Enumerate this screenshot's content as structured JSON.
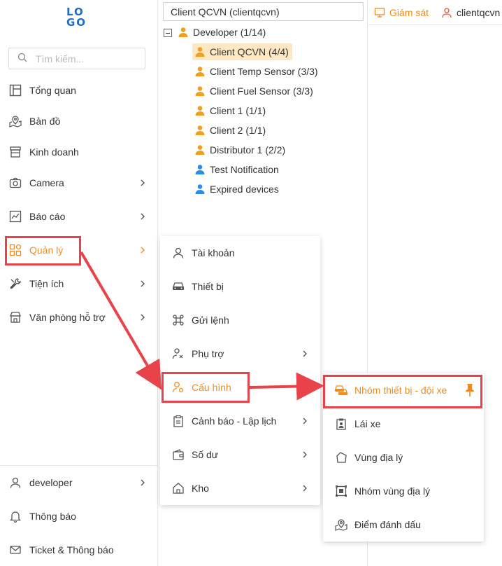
{
  "logo": {
    "line1": "LO",
    "line2": "GO"
  },
  "search": {
    "placeholder": "Tìm kiếm..."
  },
  "sidebar": {
    "items": [
      {
        "label": "Tổng quan",
        "icon": "dashboard-icon"
      },
      {
        "label": "Bản đồ",
        "icon": "map-icon"
      },
      {
        "label": "Kinh doanh",
        "icon": "store-icon"
      },
      {
        "label": "Camera",
        "icon": "camera-icon"
      },
      {
        "label": "Báo cáo",
        "icon": "report-icon"
      },
      {
        "label": "Quản lý",
        "icon": "grid-icon"
      },
      {
        "label": "Tiện ích",
        "icon": "tools-icon"
      },
      {
        "label": "Văn phòng hỗ trợ",
        "icon": "office-icon"
      }
    ],
    "bottom": [
      {
        "label": "developer",
        "icon": "user-icon"
      },
      {
        "label": "Thông báo",
        "icon": "bell-icon"
      },
      {
        "label": "Ticket & Thông báo",
        "icon": "ticket-icon"
      }
    ]
  },
  "tree": {
    "select_value": "Client QCVN (clientqcvn)",
    "root": "Developer (1/14)",
    "children": [
      {
        "label": "Client QCVN (4/4)",
        "color": "#f0a020"
      },
      {
        "label": "Client Temp Sensor (3/3)",
        "color": "#f0a020"
      },
      {
        "label": "Client Fuel Sensor (3/3)",
        "color": "#f0a020"
      },
      {
        "label": "Client 1 (1/1)",
        "color": "#f0a020"
      },
      {
        "label": "Client 2 (1/1)",
        "color": "#f0a020"
      },
      {
        "label": "Distributor 1 (2/2)",
        "color": "#f0a020"
      },
      {
        "label": "Test Notification",
        "color": "#2a8ee8"
      },
      {
        "label": "Expired devices",
        "color": "#2a8ee8"
      }
    ]
  },
  "topbar": {
    "monitor": "Giám sát",
    "user": "clientqcvn"
  },
  "menu1": {
    "items": [
      {
        "label": "Tài khoản",
        "icon": "user-icon"
      },
      {
        "label": "Thiết bị",
        "icon": "car-icon"
      },
      {
        "label": "Gửi lệnh",
        "icon": "command-icon"
      },
      {
        "label": "Phụ trợ",
        "icon": "helper-icon"
      },
      {
        "label": "Cấu hình",
        "icon": "user-settings-icon"
      },
      {
        "label": "Cảnh báo - Lập lịch",
        "icon": "clipboard-icon"
      },
      {
        "label": "Số dư",
        "icon": "wallet-icon"
      },
      {
        "label": "Kho",
        "icon": "warehouse-icon"
      }
    ]
  },
  "menu2": {
    "items": [
      {
        "label": "Nhóm thiết bị - đội xe",
        "icon": "fleet-icon"
      },
      {
        "label": "Lái xe",
        "icon": "driver-icon"
      },
      {
        "label": "Vùng địa lý",
        "icon": "polygon-icon"
      },
      {
        "label": "Nhóm vùng địa lý",
        "icon": "zone-group-icon"
      },
      {
        "label": "Điểm đánh dấu",
        "icon": "marker-icon"
      }
    ]
  },
  "colors": {
    "accent": "#f08c1e",
    "highlight": "#e8424a"
  }
}
